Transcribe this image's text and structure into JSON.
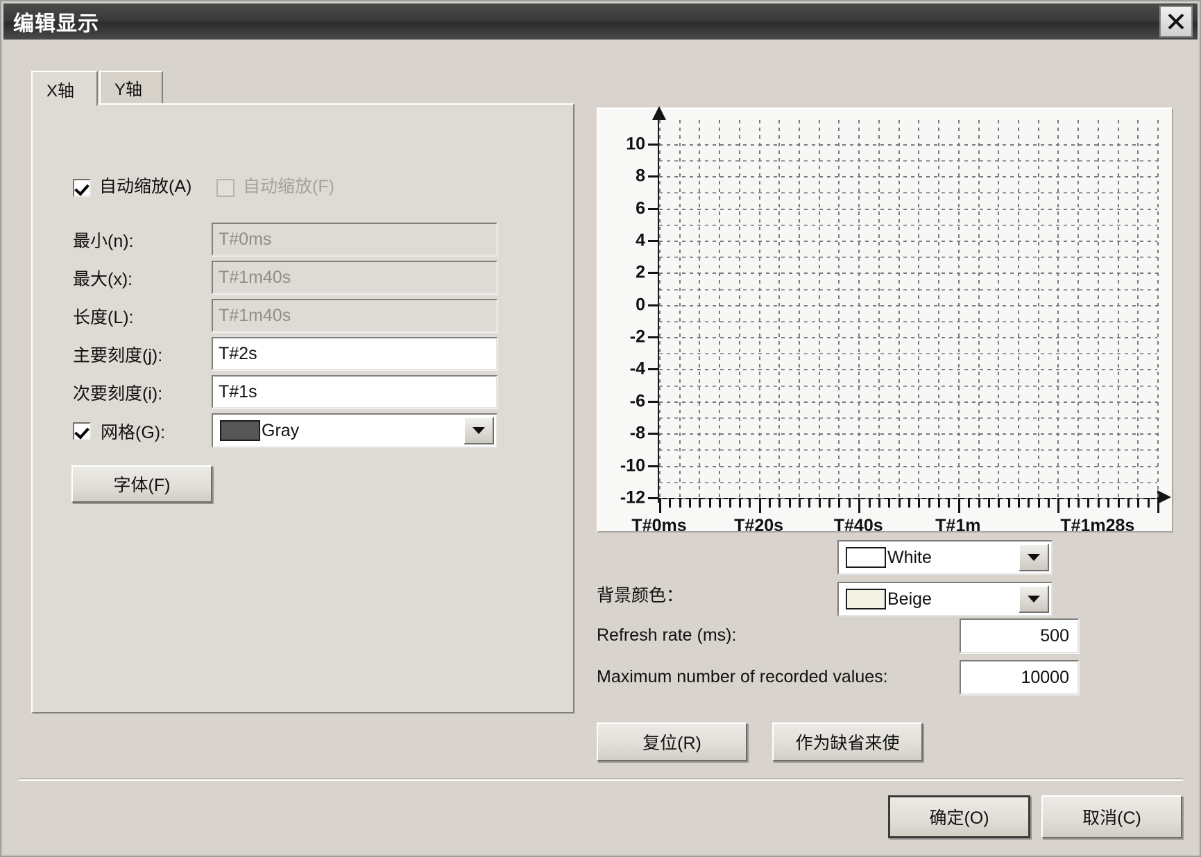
{
  "window": {
    "title": "编辑显示",
    "close_icon": "close-icon"
  },
  "tabs": [
    {
      "label": "X轴",
      "selected": true
    },
    {
      "label": "Y轴",
      "selected": false
    }
  ],
  "x_axis_panel": {
    "autoscale_a": {
      "label": "自动缩放(A)",
      "checked": true,
      "enabled": true
    },
    "autoscale_f": {
      "label": "自动缩放(F)",
      "checked": false,
      "enabled": false
    },
    "fields": [
      {
        "label": "最小(n):",
        "value": "T#0ms",
        "readonly": true
      },
      {
        "label": "最大(x):",
        "value": "T#1m40s",
        "readonly": true
      },
      {
        "label": "长度(L):",
        "value": "T#1m40s",
        "readonly": true
      },
      {
        "label": "主要刻度(j):",
        "value": "T#2s",
        "readonly": false
      },
      {
        "label": "次要刻度(i):",
        "value": "T#1s",
        "readonly": false
      }
    ],
    "grid": {
      "label": "网格(G):",
      "checked": true,
      "color_name": "Gray",
      "color_hex": "#565656"
    },
    "font_button": "字体(F)"
  },
  "preview": {
    "foreground_color": {
      "name": "White",
      "hex": "#ffffff"
    },
    "background_color": {
      "name": "Beige",
      "hex": "#f3f0e4",
      "label": "背景颜色："
    },
    "refresh_rate": {
      "label": "Refresh rate (ms):",
      "value": "500"
    },
    "max_values": {
      "label": "Maximum number of recorded values:",
      "value": "10000"
    },
    "reset_button": "复位(R)",
    "default_button": "作为缺省来使"
  },
  "footer": {
    "ok_button": "确定(O)",
    "cancel_button": "取消(C)"
  },
  "chart_data": {
    "type": "line",
    "title": "",
    "xlabel": "",
    "ylabel": "",
    "x_tick_labels": [
      "T#0ms",
      "T#20s",
      "T#40s",
      "T#1m",
      "T#1m28s"
    ],
    "x_tick_positions": [
      0,
      20,
      40,
      60,
      88
    ],
    "xlim": [
      0,
      100
    ],
    "y_tick_labels": [
      "10",
      "8",
      "6",
      "4",
      "2",
      "0",
      "-2",
      "-4",
      "-6",
      "-8",
      "-10",
      "-12"
    ],
    "y_values": [
      10,
      8,
      6,
      4,
      2,
      0,
      -2,
      -4,
      -6,
      -8,
      -10,
      -12
    ],
    "ylim": [
      -12,
      11.5
    ],
    "grid": true,
    "grid_color": "#7a7a7a",
    "grid_style": "dashed",
    "plot_background": "#f7f7f5",
    "series": [],
    "major_tick_x": "T#2s",
    "minor_tick_x": "T#1s"
  }
}
